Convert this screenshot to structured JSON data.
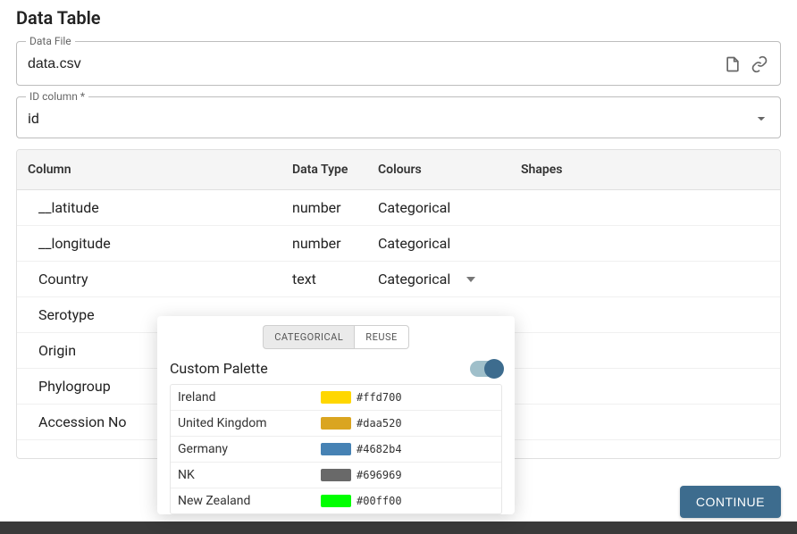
{
  "title": "Data Table",
  "dataFile": {
    "label": "Data File",
    "value": "data.csv"
  },
  "idColumn": {
    "label": "ID column *",
    "value": "id"
  },
  "headers": {
    "column": "Column",
    "dataType": "Data Type",
    "colours": "Colours",
    "shapes": "Shapes"
  },
  "rows": [
    {
      "column": "__latitude",
      "dataType": "number",
      "colours": "Categorical",
      "showCaret": false
    },
    {
      "column": "__longitude",
      "dataType": "number",
      "colours": "Categorical",
      "showCaret": false
    },
    {
      "column": "Country",
      "dataType": "text",
      "colours": "Categorical",
      "showCaret": true
    },
    {
      "column": "Serotype",
      "dataType": "",
      "colours": "",
      "showCaret": false
    },
    {
      "column": "Origin",
      "dataType": "",
      "colours": "",
      "showCaret": false
    },
    {
      "column": "Phylogroup",
      "dataType": "",
      "colours": "",
      "showCaret": false
    },
    {
      "column": "Accession No",
      "dataType": "",
      "colours": "",
      "showCaret": false
    }
  ],
  "popover": {
    "tabs": {
      "categorical": "CATEGORICAL",
      "reuse": "REUSE"
    },
    "customPaletteLabel": "Custom Palette",
    "switchOn": true,
    "palette": [
      {
        "name": "Ireland",
        "hex": "#ffd700"
      },
      {
        "name": "United Kingdom",
        "hex": "#daa520"
      },
      {
        "name": "Germany",
        "hex": "#4682b4"
      },
      {
        "name": "NK",
        "hex": "#696969"
      },
      {
        "name": "New Zealand",
        "hex": "#00ff00"
      }
    ]
  },
  "continueLabel": "CONTINUE"
}
